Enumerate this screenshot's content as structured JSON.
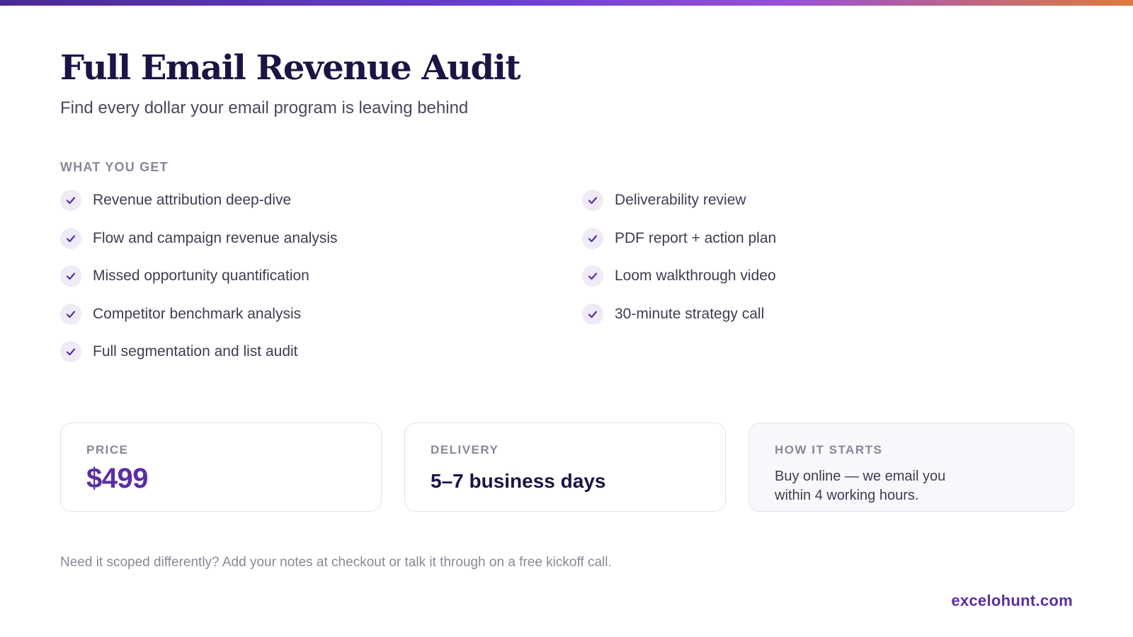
{
  "header": {
    "title": "Full Email Revenue Audit",
    "subtitle": "Find every dollar your email program is leaving behind"
  },
  "features": {
    "section_label": "WHAT YOU GET",
    "left": [
      "Revenue attribution deep-dive",
      "Flow and campaign revenue analysis",
      "Missed opportunity quantification",
      "Competitor benchmark analysis",
      "Full segmentation and list audit"
    ],
    "right": [
      "Deliverability review",
      "PDF report + action plan",
      "Loom walkthrough video",
      "30-minute strategy call"
    ],
    "icon": "check-icon"
  },
  "cards": {
    "price": {
      "label": "PRICE",
      "value": "$499"
    },
    "delivery": {
      "label": "DELIVERY",
      "value": "5–7 business days"
    },
    "how_it_starts": {
      "label": "HOW IT STARTS",
      "value": "Buy online — we email you within 4 working hours."
    }
  },
  "footer": {
    "note": "Need it scoped differently? Add your notes at checkout or talk it through on a free kickoff call.",
    "brand": "excelohunt.com"
  },
  "colors": {
    "accent": "#5b2ea3",
    "heading": "#1b1545",
    "muted": "#8a8799"
  }
}
